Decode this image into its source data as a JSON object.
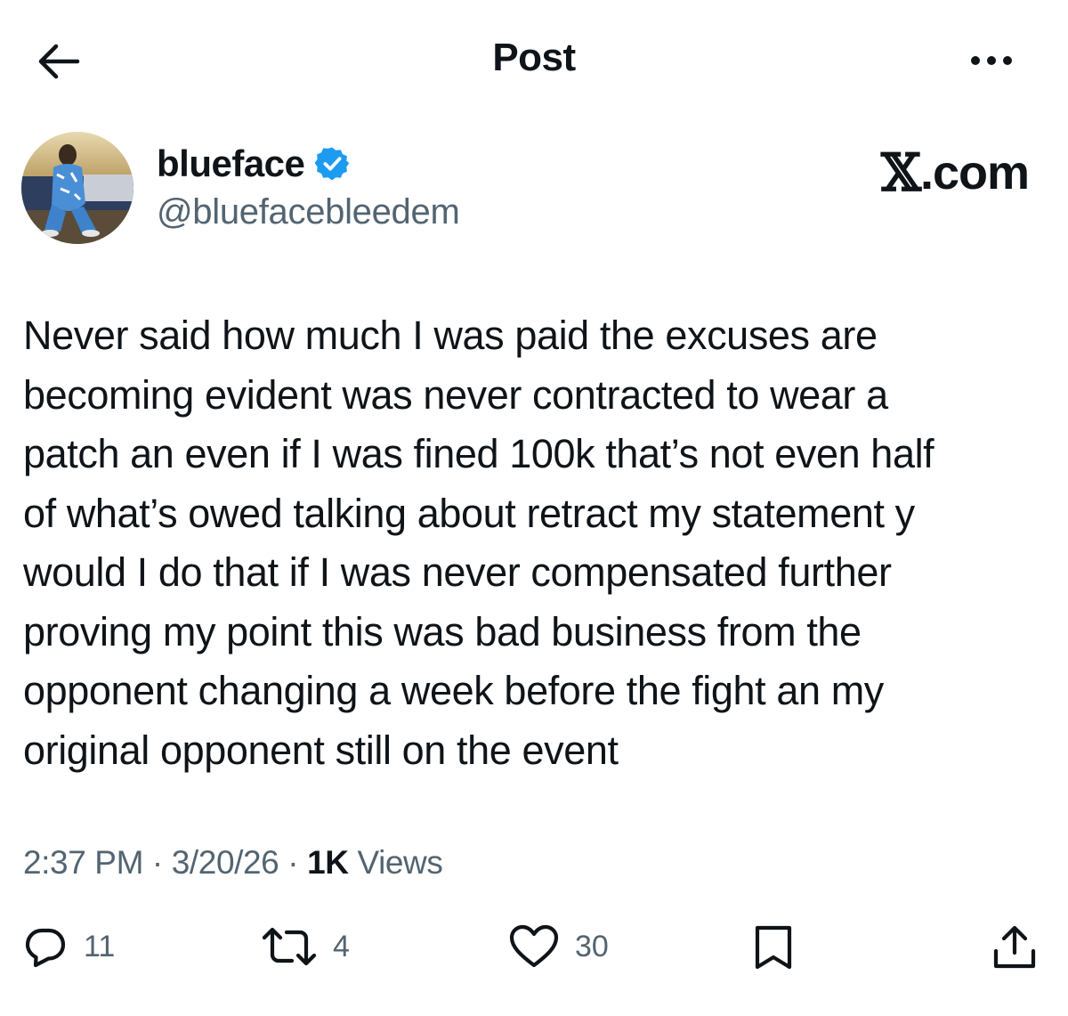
{
  "header": {
    "title": "Post",
    "back_icon": "arrow-left-icon",
    "more_icon": "more-horizontal-icon"
  },
  "author": {
    "display_name": "blueface",
    "handle": "@bluefacebleedem",
    "verified": true,
    "verified_color": "#1d9bf0"
  },
  "watermark": {
    "mark": "𝕏",
    "suffix": ".com"
  },
  "post": {
    "text": "Never said how much I was paid the excuses are\nbecoming evident was never contracted to wear a\npatch an even if I was fined 100k that’s not even half\nof what’s owed talking about retract my statement y\nwould I do that if I was never compensated further\nproving my point this was bad business from the\nopponent changing a week before the fight an my\noriginal opponent still on the event",
    "time": "2:37 PM",
    "date": "3/20/26",
    "separator": "·",
    "views_count": "1K",
    "views_label": "Views"
  },
  "actions": {
    "reply": {
      "icon": "reply-icon",
      "count": "11"
    },
    "repost": {
      "icon": "repost-icon",
      "count": "4"
    },
    "like": {
      "icon": "heart-icon",
      "count": "30"
    },
    "bookmark": {
      "icon": "bookmark-icon"
    },
    "share": {
      "icon": "share-icon"
    }
  },
  "colors": {
    "text": "#0f1419",
    "secondary": "#536471",
    "accent": "#1d9bf0"
  }
}
